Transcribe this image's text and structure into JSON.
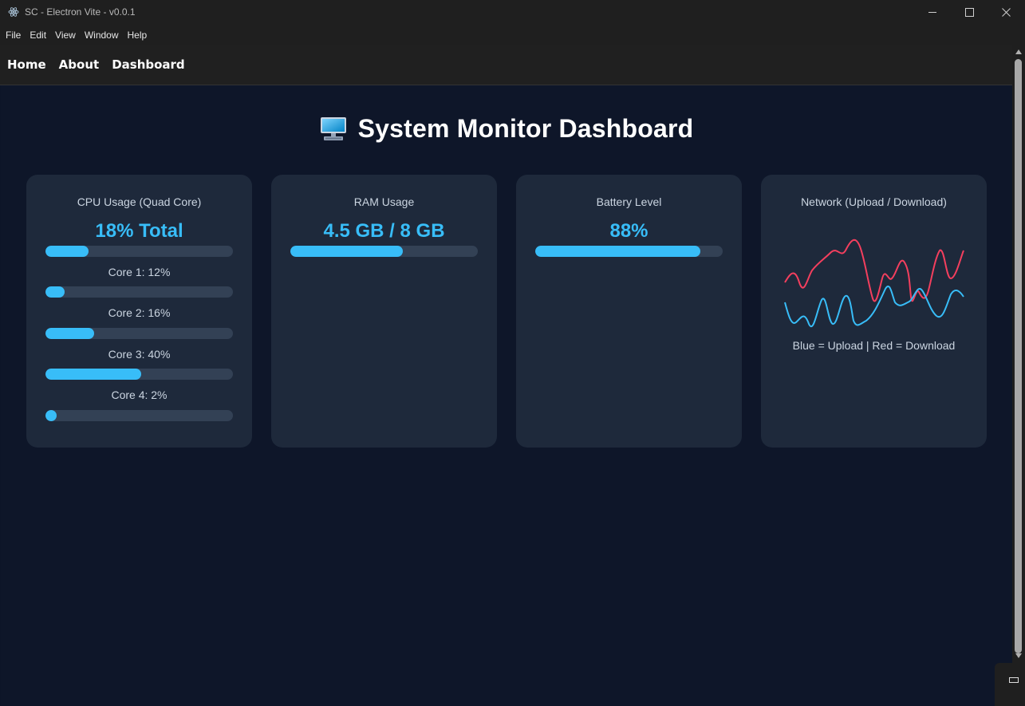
{
  "window": {
    "title": "SC - Electron Vite - v0.0.1"
  },
  "menu": [
    "File",
    "Edit",
    "View",
    "Window",
    "Help"
  ],
  "nav": [
    "Home",
    "About",
    "Dashboard"
  ],
  "dashboard": {
    "heading": "System Monitor Dashboard",
    "heading_icon": "desktop-computer-icon",
    "cpu": {
      "title": "CPU Usage (Quad Core)",
      "total_label": "18% Total",
      "total_percent": 23,
      "cores": [
        {
          "label": "Core 1: 12%",
          "percent": 10
        },
        {
          "label": "Core 2: 16%",
          "percent": 26
        },
        {
          "label": "Core 3: 40%",
          "percent": 51
        },
        {
          "label": "Core 4: 2%",
          "percent": 6
        }
      ]
    },
    "ram": {
      "title": "RAM Usage",
      "value_label": "4.5 GB / 8 GB",
      "percent": 60
    },
    "battery": {
      "title": "Battery Level",
      "value_label": "88%",
      "percent": 88
    },
    "network": {
      "title": "Network (Upload / Download)",
      "caption": "Blue = Upload | Red = Download",
      "upload_color": "#38bdf8",
      "download_color": "#f43f5e"
    }
  },
  "colors": {
    "accent": "#38bdf8",
    "card_bg": "#1e293b",
    "page_bg": "#0e1629",
    "bar_track": "#334155"
  }
}
